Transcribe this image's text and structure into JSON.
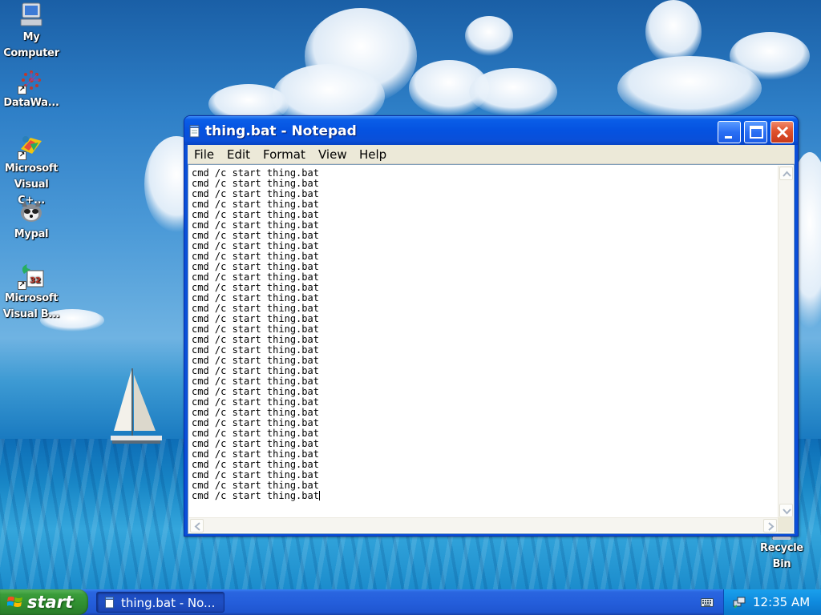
{
  "desktop": {
    "icons": [
      {
        "label": "My\nComputer",
        "icon": "my-computer-icon"
      },
      {
        "label": "DataWa...",
        "icon": "datawarrior-icon"
      },
      {
        "label": "Microsoft\nVisual C+...",
        "icon": "visual-cpp-icon"
      },
      {
        "label": "Mypal",
        "icon": "mypal-icon"
      },
      {
        "label": "Microsoft\nVisual B...",
        "icon": "visual-basic-icon"
      },
      {
        "label": "Recycle\nBin",
        "icon": "recycle-bin-icon"
      }
    ]
  },
  "window": {
    "title": "thing.bat - Notepad",
    "menu": [
      "File",
      "Edit",
      "Format",
      "View",
      "Help"
    ],
    "content_line": "cmd /c start thing.bat",
    "line_count": 32
  },
  "taskbar": {
    "start_label": "start",
    "task_button_label": "thing.bat - No...",
    "clock": "12:35 AM"
  },
  "colors": {
    "titlebar": "#0a4fd8",
    "close_button": "#e0522c",
    "start_button": "#3a9c3a",
    "taskbar": "#245edb",
    "tray": "#0f8ade"
  }
}
